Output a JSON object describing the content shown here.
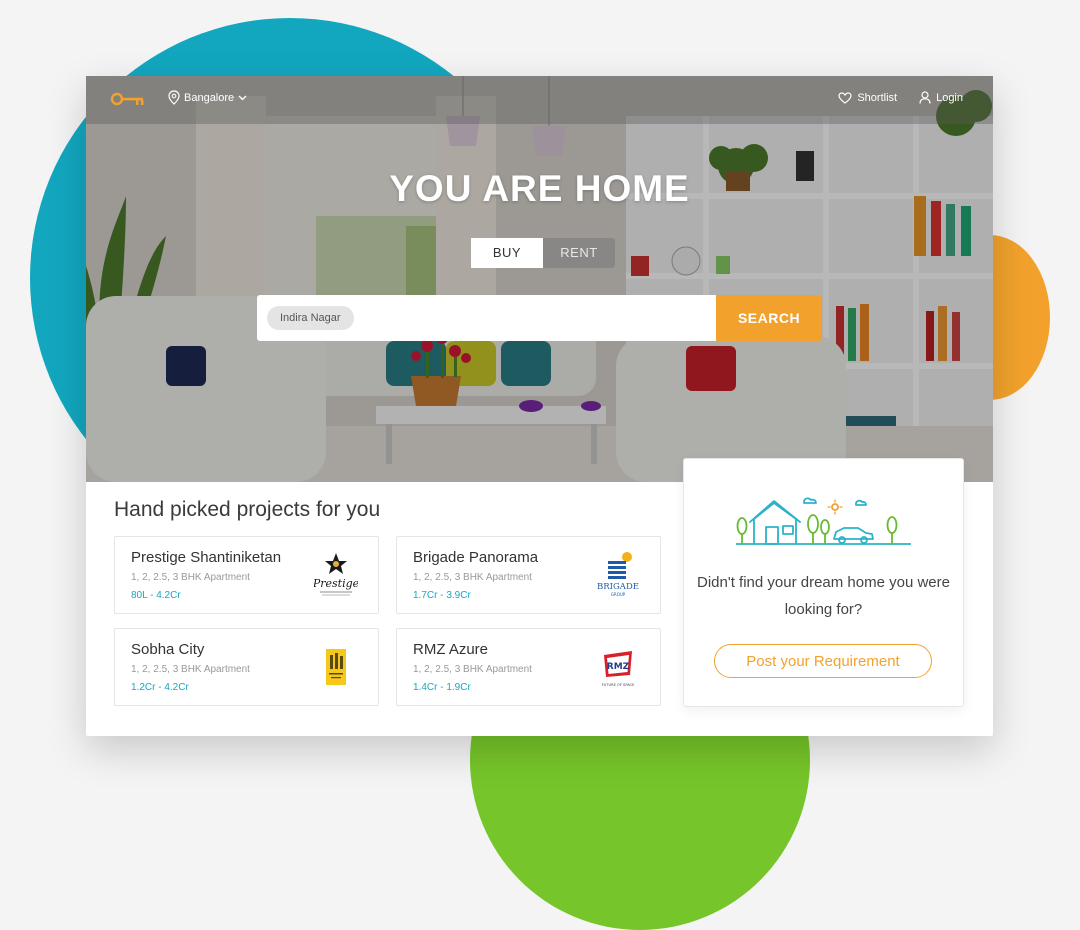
{
  "header": {
    "city": "Bangalore",
    "shortlist_label": "Shortlist",
    "login_label": "Login"
  },
  "hero": {
    "headline": "YOU ARE HOME",
    "tabs": {
      "buy": "BUY",
      "rent": "RENT",
      "selected": "BUY"
    },
    "search": {
      "chip": "Indira Nagar",
      "button_label": "SEARCH"
    }
  },
  "projects": {
    "title": "Hand picked projects for you",
    "items": [
      {
        "name": "Prestige Shantiniketan",
        "type": "1, 2, 2.5, 3 BHK Apartment",
        "price": "80L - 4.2Cr",
        "logo_icon": "prestige-logo"
      },
      {
        "name": "Brigade Panorama",
        "type": "1, 2, 2.5, 3 BHK Apartment",
        "price": "1.7Cr - 3.9Cr",
        "logo_icon": "brigade-logo"
      },
      {
        "name": "Sobha City",
        "type": "1, 2, 2.5, 3 BHK Apartment",
        "price": "1.2Cr - 4.2Cr",
        "logo_icon": "sobha-logo"
      },
      {
        "name": "RMZ Azure",
        "type": "1, 2, 2.5, 3 BHK Apartment",
        "price": "1.4Cr - 1.9Cr",
        "logo_icon": "rmz-logo"
      }
    ]
  },
  "requirement": {
    "message": "Didn't find your dream home you were looking for?",
    "button_label": "Post your Requirement"
  },
  "colors": {
    "accent_orange": "#f2a22c",
    "accent_teal": "#17a7c0",
    "bg_blob_teal": "#12a7bf",
    "bg_blob_green": "#76c52a"
  }
}
